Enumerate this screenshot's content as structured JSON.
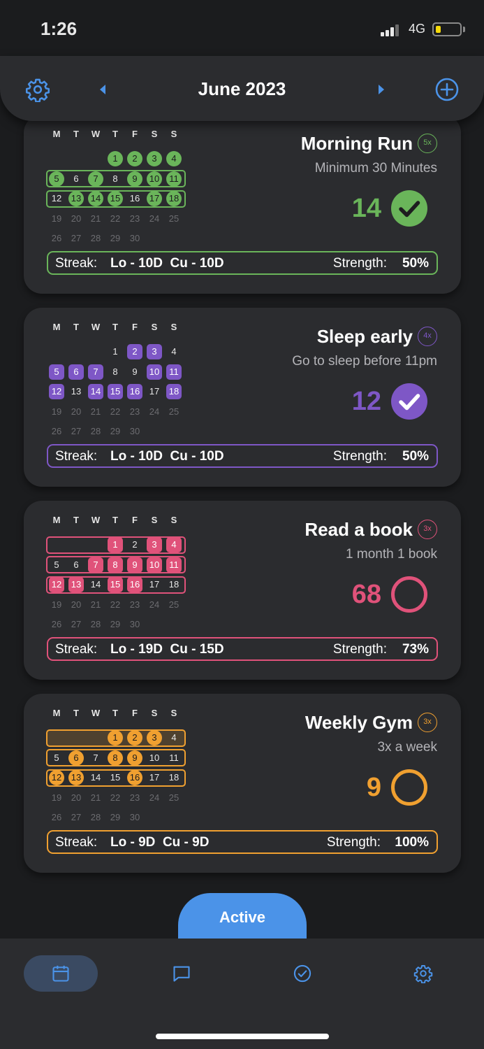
{
  "status_bar": {
    "time": "1:26",
    "network": "4G"
  },
  "header": {
    "title": "June 2023"
  },
  "weekdays": [
    "M",
    "T",
    "W",
    "T",
    "F",
    "S",
    "S"
  ],
  "habits": [
    {
      "title": "Morning Run",
      "frequency": "5x",
      "description": "Minimum 30 Minutes",
      "count": "14",
      "completed_today": true,
      "color": "#6ab55a",
      "marker": "circle",
      "done_days": [
        1,
        2,
        3,
        4,
        5,
        7,
        9,
        10,
        11,
        13,
        14,
        15,
        17,
        18
      ],
      "streak_label": "Streak:",
      "streak_value": "Lo - 10D  Cu - 10D",
      "strength_label": "Strength:",
      "strength_value": "50%"
    },
    {
      "title": "Sleep early",
      "frequency": "4x",
      "description": "Go to sleep before 11pm",
      "count": "12",
      "completed_today": true,
      "color": "#7e57c6",
      "marker": "square",
      "done_days": [
        2,
        3,
        5,
        6,
        7,
        10,
        11,
        12,
        14,
        15,
        16,
        18
      ],
      "streak_label": "Streak:",
      "streak_value": "Lo - 10D  Cu - 10D",
      "strength_label": "Strength:",
      "strength_value": "50%"
    },
    {
      "title": "Read a book",
      "frequency": "3x",
      "description": "1 month 1 book",
      "count": "68",
      "completed_today": false,
      "color": "#e0527a",
      "marker": "square",
      "done_days": [
        1,
        3,
        4,
        7,
        8,
        9,
        10,
        11,
        12,
        13,
        15,
        16
      ],
      "streak_label": "Streak:",
      "streak_value": "Lo - 19D  Cu - 15D",
      "strength_label": "Strength:",
      "strength_value": "73%"
    },
    {
      "title": "Weekly Gym",
      "frequency": "3x",
      "description": "3x a week",
      "count": "9",
      "completed_today": false,
      "color": "#f0a030",
      "marker": "circle",
      "done_days": [
        1,
        2,
        3,
        6,
        8,
        9,
        12,
        13,
        16
      ],
      "streak_label": "Streak:",
      "streak_value": "Lo - 9D  Cu - 9D",
      "strength_label": "Strength:",
      "strength_value": "100%"
    }
  ],
  "active_tab": {
    "label": "Active"
  },
  "bottom_nav": {
    "items": [
      {
        "icon": "calendar-icon",
        "selected": true
      },
      {
        "icon": "chat-icon",
        "selected": false
      },
      {
        "icon": "check-circle-icon",
        "selected": false
      },
      {
        "icon": "gear-icon",
        "selected": false
      }
    ]
  },
  "colors": {
    "accent": "#4b93e8",
    "background": "#1b1c1e",
    "card": "#2b2c2f"
  }
}
